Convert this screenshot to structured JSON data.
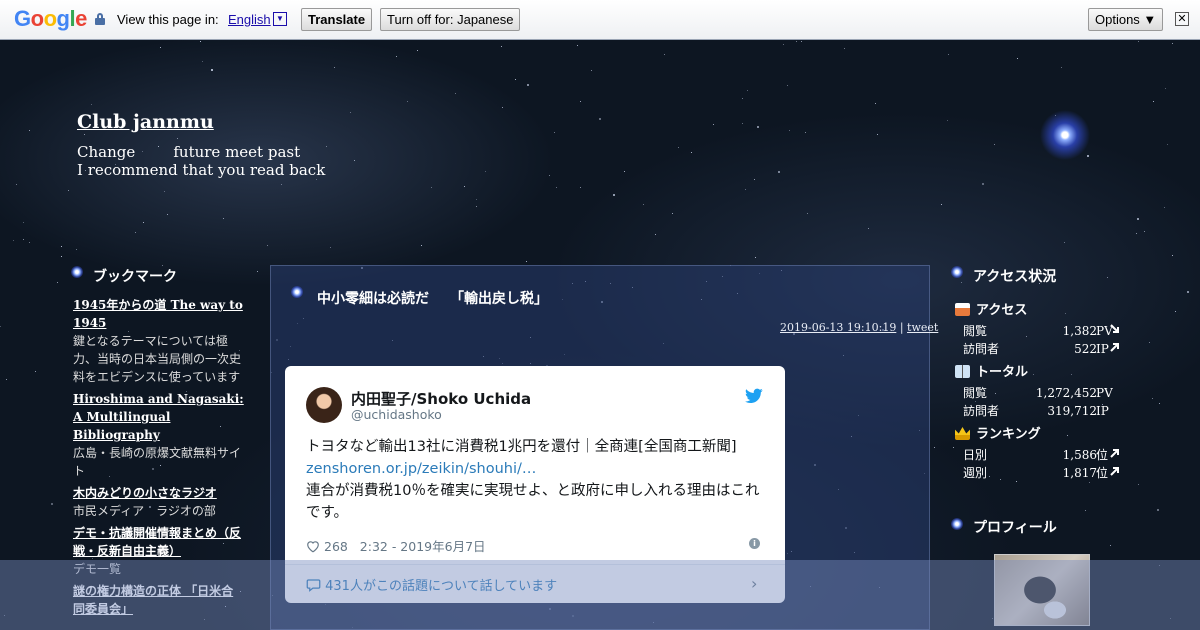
{
  "translate_bar": {
    "logo": "Google",
    "view_text": "View this page in:",
    "language": "English",
    "translate_label": "Translate",
    "turn_off_label": "Turn off for: Japanese",
    "options_label": "Options ▼",
    "close_label": "✕"
  },
  "header": {
    "title": "Club jannmu",
    "tagline": "Change        future meet past\nI recommend that you read back"
  },
  "bookmarks": {
    "heading": "ブックマーク",
    "items": [
      {
        "title": "1945年からの道 The way to 1945",
        "desc": "鍵となるテーマについては極力、当時の日本当局側の一次史料をエビデンスに使っています"
      },
      {
        "title": "Hiroshima and Nagasaki: A Multilingual Bibliography",
        "desc": "広島・長崎の原爆文献無料サイト"
      },
      {
        "title": "木内みどりの小さなラジオ",
        "desc": "市民メディア　ラジオの部"
      },
      {
        "title": "デモ・抗議開催情報まとめ（反戦・反新自由主義）",
        "desc": "デモ一覧"
      },
      {
        "title": "謎の権力構造の正体 「日米合同委員会」",
        "desc": ""
      }
    ]
  },
  "entry": {
    "title": "中小零細は必読だ　　「輸出戻し税」",
    "date": "2019-06-13 19:10:19",
    "separator": " | ",
    "category": "tweet"
  },
  "tweet": {
    "name": "内田聖子/Shoko Uchida",
    "handle": "@uchidashoko",
    "text_line1": "トヨタなど輸出13社に消費税1兆円を還付｜全商連[全国商工新聞] ",
    "link": "zenshoren.or.jp/zeikin/shouhi/…",
    "text_line2": "連合が消費税10％を確実に実現せよ、と政府に申し入れる理由はこれです。",
    "likes": "268",
    "time": "2:32 - 2019年6月7日",
    "conversation": "431人がこの話題について話しています"
  },
  "access": {
    "heading": "アクセス状況",
    "sections": [
      {
        "label": "アクセス",
        "rows": [
          {
            "k": "閲覧",
            "v": "1,382",
            "u": "PV",
            "arrow": "down"
          },
          {
            "k": "訪問者",
            "v": "522",
            "u": "IP",
            "arrow": "up"
          }
        ]
      },
      {
        "label": "トータル",
        "rows": [
          {
            "k": "閲覧",
            "v": "1,272,452",
            "u": "PV",
            "arrow": ""
          },
          {
            "k": "訪問者",
            "v": "319,712",
            "u": "IP",
            "arrow": ""
          }
        ]
      },
      {
        "label": "ランキング",
        "rows": [
          {
            "k": "日別",
            "v": "1,586",
            "u": "位",
            "arrow": "up"
          },
          {
            "k": "週別",
            "v": "1,817",
            "u": "位",
            "arrow": "up"
          }
        ]
      }
    ]
  },
  "profile": {
    "heading": "プロフィール"
  },
  "colors": {
    "twitter_blue": "#1da1f2",
    "link_blue": "#2b7bb9"
  }
}
